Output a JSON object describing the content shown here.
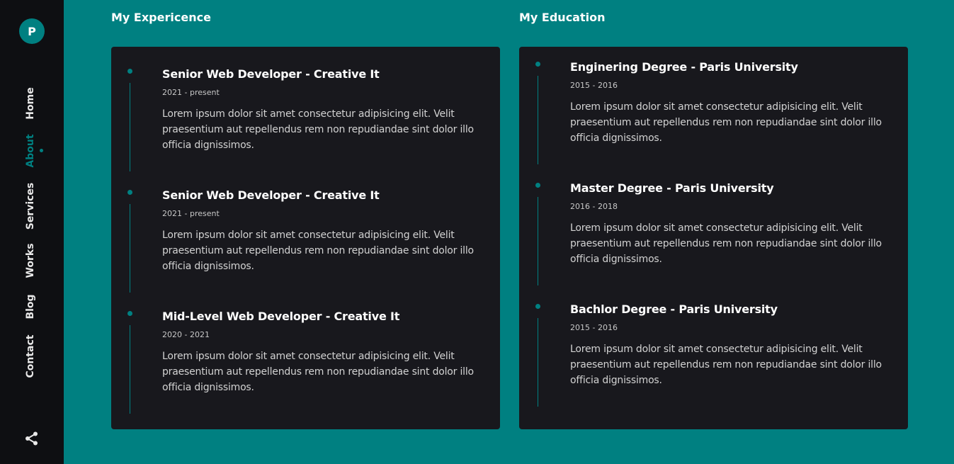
{
  "sidebar": {
    "avatar_letter": "P",
    "nav": [
      {
        "label": "Home"
      },
      {
        "label": "About"
      },
      {
        "label": "Services"
      },
      {
        "label": "Works"
      },
      {
        "label": "Blog"
      },
      {
        "label": "Contact"
      }
    ],
    "active_item": "About",
    "share_icon": "share-icon"
  },
  "experience": {
    "title": "My Expericence",
    "items": [
      {
        "title": "Senior Web Developer - Creative It",
        "date": "2021 - present",
        "description": "Lorem ipsum dolor sit amet consectetur adipisicing elit. Velit praesentium aut repellendus rem non repudiandae sint dolor illo officia dignissimos."
      },
      {
        "title": "Senior Web Developer - Creative It",
        "date": "2021 - present",
        "description": "Lorem ipsum dolor sit amet consectetur adipisicing elit. Velit praesentium aut repellendus rem non repudiandae sint dolor illo officia dignissimos."
      },
      {
        "title": "Mid-Level Web Developer - Creative It",
        "date": "2020 - 2021",
        "description": "Lorem ipsum dolor sit amet consectetur adipisicing elit. Velit praesentium aut repellendus rem non repudiandae sint dolor illo officia dignissimos."
      }
    ]
  },
  "education": {
    "title": "My Education",
    "items": [
      {
        "title": "Enginering Degree - Paris University",
        "date": "2015 - 2016",
        "description": "Lorem ipsum dolor sit amet consectetur adipisicing elit. Velit praesentium aut repellendus rem non repudiandae sint dolor illo officia dignissimos."
      },
      {
        "title": "Master Degree - Paris University",
        "date": "2016 - 2018",
        "description": "Lorem ipsum dolor sit amet consectetur adipisicing elit. Velit praesentium aut repellendus rem non repudiandae sint dolor illo officia dignissimos."
      },
      {
        "title": "Bachlor Degree - Paris University",
        "date": "2015 - 2016",
        "description": "Lorem ipsum dolor sit amet consectetur adipisicing elit. Velit praesentium aut repellendus rem non repudiandae sint dolor illo officia dignissimos."
      }
    ]
  },
  "colors": {
    "accent": "#008081",
    "sidebar_bg": "#0e0f12",
    "card_bg": "#18181d",
    "text": "#ffffff"
  }
}
